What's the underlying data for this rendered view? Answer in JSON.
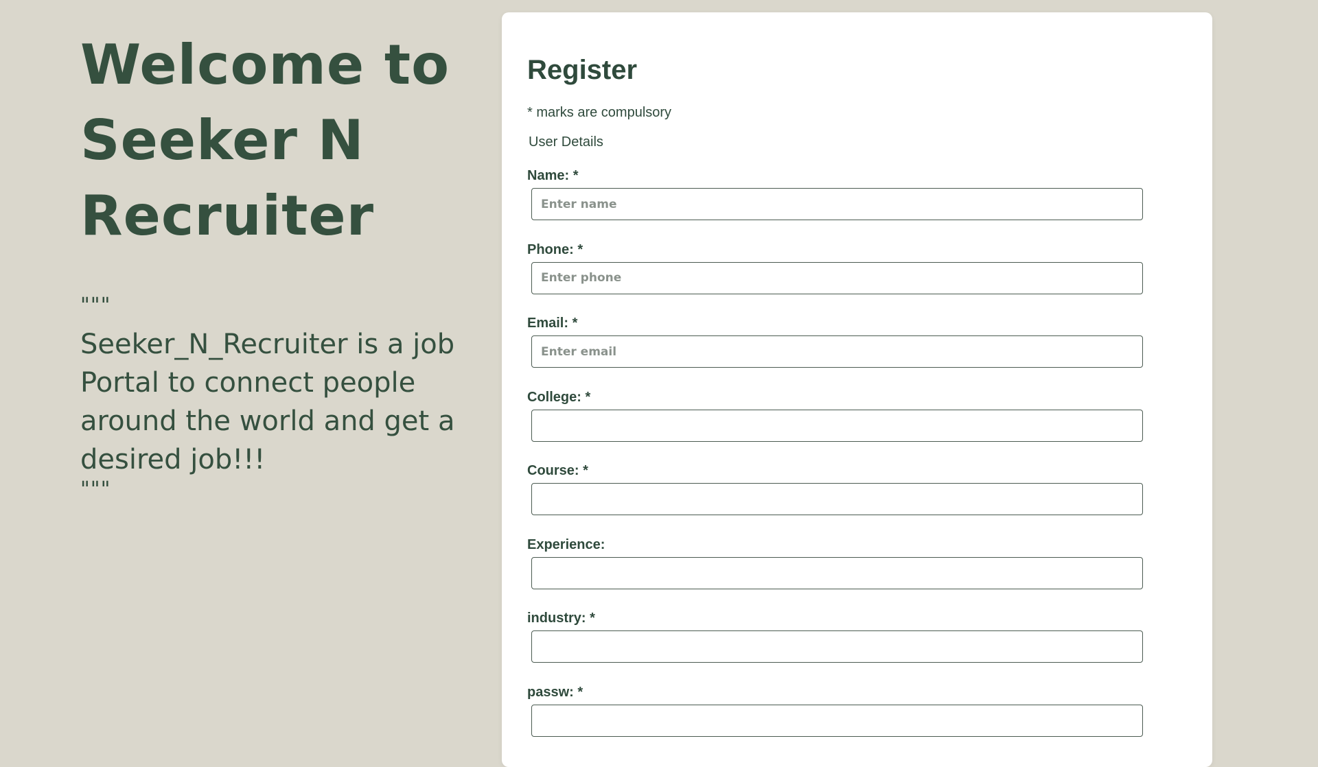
{
  "hero": {
    "title_line1": "Welcome to",
    "title_line2": "Seeker N",
    "title_line3": "Recruiter",
    "quote_open": "\"\"\"",
    "tagline": "Seeker_N_Recruiter is a job Portal to connect people around the world and get a desired job!!!",
    "quote_close": "\"\"\""
  },
  "form": {
    "title": "Register",
    "note": "* marks are compulsory",
    "section": "User Details",
    "fields": [
      {
        "label": "Name: *",
        "placeholder": "Enter name",
        "value": ""
      },
      {
        "label": "Phone: *",
        "placeholder": "Enter phone",
        "value": ""
      },
      {
        "label": "Email: *",
        "placeholder": "Enter email",
        "value": ""
      },
      {
        "label": "College: *",
        "placeholder": "",
        "value": ""
      },
      {
        "label": "Course: *",
        "placeholder": "",
        "value": ""
      },
      {
        "label": "Experience:",
        "placeholder": "",
        "value": ""
      },
      {
        "label": "industry: *",
        "placeholder": "",
        "value": ""
      },
      {
        "label": "passw: *",
        "placeholder": "",
        "value": ""
      }
    ]
  },
  "colors": {
    "background": "#dad7cc",
    "card": "#ffffff",
    "text": "#2f4a3c"
  }
}
